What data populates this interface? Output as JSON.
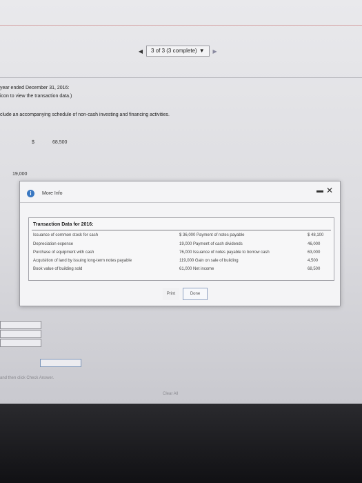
{
  "pager": {
    "label": "3 of 3 (3 complete)"
  },
  "question": {
    "line1": "year ended December 31, 2016:",
    "line2": "icon to view the transaction data.)",
    "line3": "clude an accompanying schedule of non-cash investing and financing activities."
  },
  "form": {
    "currency": "$",
    "amount1": "68,500",
    "amount2": "19,000"
  },
  "modal": {
    "title": "More Info",
    "panel_title": "Transaction Data for 2016:",
    "left_items": [
      "Issuance of common stock for cash",
      "Depreciation expense",
      "Purchase of equipment with cash",
      "Acquisition of land by issuing long-term notes payable",
      "Book value of building sold"
    ],
    "mid_items": [
      "$ 36,000 Payment of notes payable",
      "19,000 Payment of cash dividends",
      "76,000 Issuance of notes payable to borrow cash",
      "119,000 Gain on sale of building",
      "61,000 Net income"
    ],
    "right_values": [
      "$ 48,100",
      "46,000",
      "63,000",
      "4,500",
      "68,500"
    ],
    "print_label": "Print",
    "done_label": "Done"
  },
  "footer": {
    "instruction": "and then click Check Answer.",
    "clear_all": "Clear All"
  }
}
